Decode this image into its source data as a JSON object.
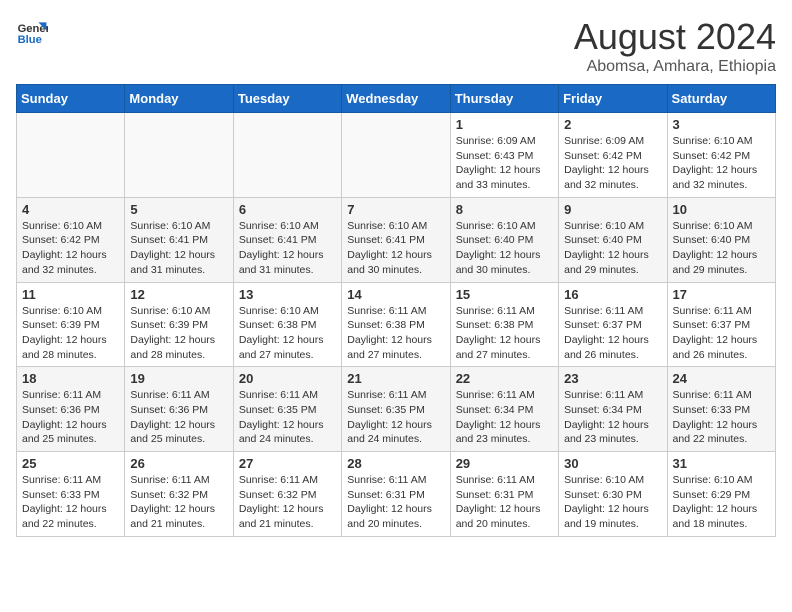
{
  "header": {
    "logo_line1": "General",
    "logo_line2": "Blue",
    "title": "August 2024",
    "subtitle": "Abomsa, Amhara, Ethiopia"
  },
  "weekdays": [
    "Sunday",
    "Monday",
    "Tuesday",
    "Wednesday",
    "Thursday",
    "Friday",
    "Saturday"
  ],
  "weeks": [
    [
      {
        "day": "",
        "info": ""
      },
      {
        "day": "",
        "info": ""
      },
      {
        "day": "",
        "info": ""
      },
      {
        "day": "",
        "info": ""
      },
      {
        "day": "1",
        "info": "Sunrise: 6:09 AM\nSunset: 6:43 PM\nDaylight: 12 hours\nand 33 minutes."
      },
      {
        "day": "2",
        "info": "Sunrise: 6:09 AM\nSunset: 6:42 PM\nDaylight: 12 hours\nand 32 minutes."
      },
      {
        "day": "3",
        "info": "Sunrise: 6:10 AM\nSunset: 6:42 PM\nDaylight: 12 hours\nand 32 minutes."
      }
    ],
    [
      {
        "day": "4",
        "info": "Sunrise: 6:10 AM\nSunset: 6:42 PM\nDaylight: 12 hours\nand 32 minutes."
      },
      {
        "day": "5",
        "info": "Sunrise: 6:10 AM\nSunset: 6:41 PM\nDaylight: 12 hours\nand 31 minutes."
      },
      {
        "day": "6",
        "info": "Sunrise: 6:10 AM\nSunset: 6:41 PM\nDaylight: 12 hours\nand 31 minutes."
      },
      {
        "day": "7",
        "info": "Sunrise: 6:10 AM\nSunset: 6:41 PM\nDaylight: 12 hours\nand 30 minutes."
      },
      {
        "day": "8",
        "info": "Sunrise: 6:10 AM\nSunset: 6:40 PM\nDaylight: 12 hours\nand 30 minutes."
      },
      {
        "day": "9",
        "info": "Sunrise: 6:10 AM\nSunset: 6:40 PM\nDaylight: 12 hours\nand 29 minutes."
      },
      {
        "day": "10",
        "info": "Sunrise: 6:10 AM\nSunset: 6:40 PM\nDaylight: 12 hours\nand 29 minutes."
      }
    ],
    [
      {
        "day": "11",
        "info": "Sunrise: 6:10 AM\nSunset: 6:39 PM\nDaylight: 12 hours\nand 28 minutes."
      },
      {
        "day": "12",
        "info": "Sunrise: 6:10 AM\nSunset: 6:39 PM\nDaylight: 12 hours\nand 28 minutes."
      },
      {
        "day": "13",
        "info": "Sunrise: 6:10 AM\nSunset: 6:38 PM\nDaylight: 12 hours\nand 27 minutes."
      },
      {
        "day": "14",
        "info": "Sunrise: 6:11 AM\nSunset: 6:38 PM\nDaylight: 12 hours\nand 27 minutes."
      },
      {
        "day": "15",
        "info": "Sunrise: 6:11 AM\nSunset: 6:38 PM\nDaylight: 12 hours\nand 27 minutes."
      },
      {
        "day": "16",
        "info": "Sunrise: 6:11 AM\nSunset: 6:37 PM\nDaylight: 12 hours\nand 26 minutes."
      },
      {
        "day": "17",
        "info": "Sunrise: 6:11 AM\nSunset: 6:37 PM\nDaylight: 12 hours\nand 26 minutes."
      }
    ],
    [
      {
        "day": "18",
        "info": "Sunrise: 6:11 AM\nSunset: 6:36 PM\nDaylight: 12 hours\nand 25 minutes."
      },
      {
        "day": "19",
        "info": "Sunrise: 6:11 AM\nSunset: 6:36 PM\nDaylight: 12 hours\nand 25 minutes."
      },
      {
        "day": "20",
        "info": "Sunrise: 6:11 AM\nSunset: 6:35 PM\nDaylight: 12 hours\nand 24 minutes."
      },
      {
        "day": "21",
        "info": "Sunrise: 6:11 AM\nSunset: 6:35 PM\nDaylight: 12 hours\nand 24 minutes."
      },
      {
        "day": "22",
        "info": "Sunrise: 6:11 AM\nSunset: 6:34 PM\nDaylight: 12 hours\nand 23 minutes."
      },
      {
        "day": "23",
        "info": "Sunrise: 6:11 AM\nSunset: 6:34 PM\nDaylight: 12 hours\nand 23 minutes."
      },
      {
        "day": "24",
        "info": "Sunrise: 6:11 AM\nSunset: 6:33 PM\nDaylight: 12 hours\nand 22 minutes."
      }
    ],
    [
      {
        "day": "25",
        "info": "Sunrise: 6:11 AM\nSunset: 6:33 PM\nDaylight: 12 hours\nand 22 minutes."
      },
      {
        "day": "26",
        "info": "Sunrise: 6:11 AM\nSunset: 6:32 PM\nDaylight: 12 hours\nand 21 minutes."
      },
      {
        "day": "27",
        "info": "Sunrise: 6:11 AM\nSunset: 6:32 PM\nDaylight: 12 hours\nand 21 minutes."
      },
      {
        "day": "28",
        "info": "Sunrise: 6:11 AM\nSunset: 6:31 PM\nDaylight: 12 hours\nand 20 minutes."
      },
      {
        "day": "29",
        "info": "Sunrise: 6:11 AM\nSunset: 6:31 PM\nDaylight: 12 hours\nand 20 minutes."
      },
      {
        "day": "30",
        "info": "Sunrise: 6:10 AM\nSunset: 6:30 PM\nDaylight: 12 hours\nand 19 minutes."
      },
      {
        "day": "31",
        "info": "Sunrise: 6:10 AM\nSunset: 6:29 PM\nDaylight: 12 hours\nand 18 minutes."
      }
    ]
  ]
}
